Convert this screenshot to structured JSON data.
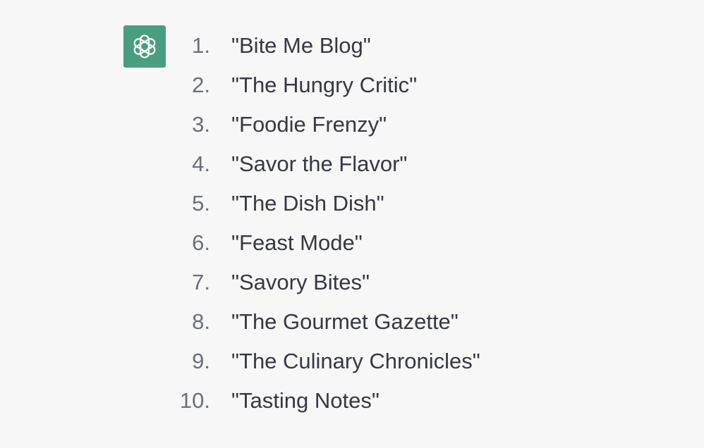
{
  "assistant": {
    "avatar_icon": "openai-logo-icon",
    "avatar_color": "#4a9e80"
  },
  "response": {
    "items": [
      {
        "number": "1.",
        "text": "\"Bite Me Blog\""
      },
      {
        "number": "2.",
        "text": "\"The Hungry Critic\""
      },
      {
        "number": "3.",
        "text": "\"Foodie Frenzy\""
      },
      {
        "number": "4.",
        "text": "\"Savor the Flavor\""
      },
      {
        "number": "5.",
        "text": "\"The Dish Dish\""
      },
      {
        "number": "6.",
        "text": "\"Feast Mode\""
      },
      {
        "number": "7.",
        "text": "\"Savory Bites\""
      },
      {
        "number": "8.",
        "text": "\"The Gourmet Gazette\""
      },
      {
        "number": "9.",
        "text": "\"The Culinary Chronicles\""
      },
      {
        "number": "10.",
        "text": "\"Tasting Notes\""
      }
    ]
  }
}
